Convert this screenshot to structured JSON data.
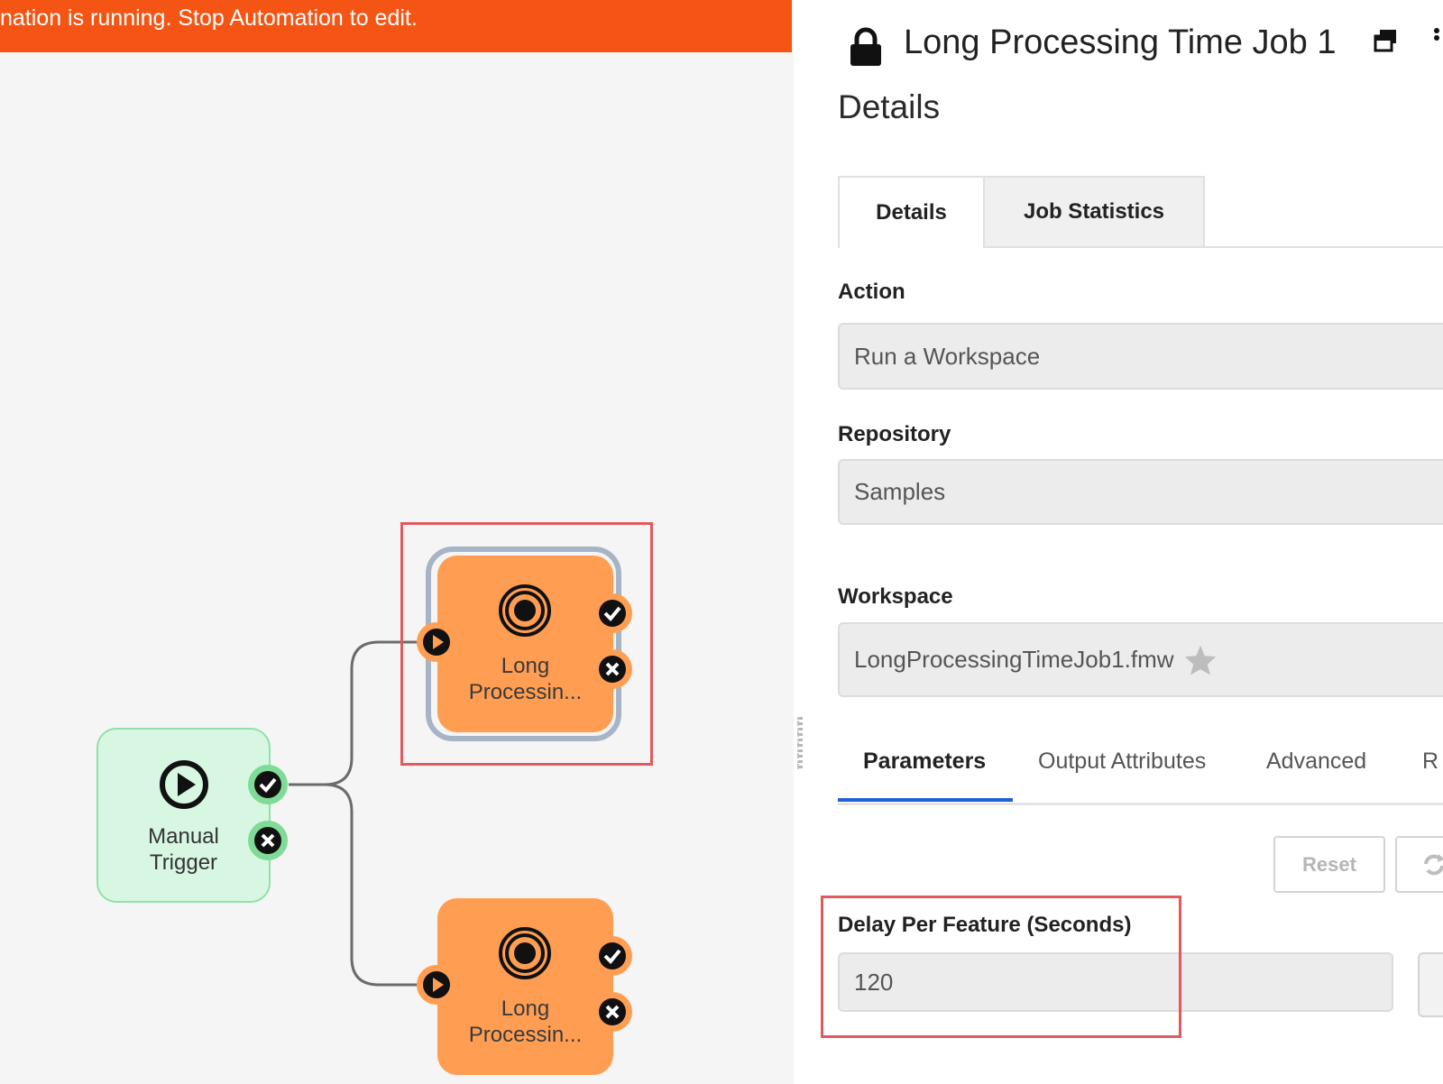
{
  "banner": {
    "text": "nation is running. Stop Automation to edit."
  },
  "colors": {
    "banner": "#f55514",
    "trigger_node": "#d7f7e2",
    "job_node": "#ff9e52",
    "selection": "#e3595d",
    "success_port": "#7fdb97",
    "active_tab": "#1f5fd6"
  },
  "canvas": {
    "trigger": {
      "label_line1": "Manual",
      "label_line2": "Trigger",
      "icon": "play-circle-icon"
    },
    "job1": {
      "label_line1": "Long",
      "label_line2": "Processin...",
      "icon": "target-icon"
    },
    "job2": {
      "label_line1": "Long",
      "label_line2": "Processin...",
      "icon": "target-icon"
    }
  },
  "panel": {
    "title": "Long Processing Time Job 1",
    "subheading": "Details",
    "tabs": [
      "Details",
      "Job Statistics"
    ],
    "action": {
      "label": "Action",
      "value": "Run a Workspace"
    },
    "repository": {
      "label": "Repository",
      "value": "Samples"
    },
    "workspace": {
      "label": "Workspace",
      "value": "LongProcessingTimeJob1.fmw"
    },
    "subtabs": [
      "Parameters",
      "Output Attributes",
      "Advanced",
      "R"
    ],
    "reset_label": "Reset",
    "parameter": {
      "label": "Delay Per Feature (Seconds)",
      "value": "120"
    }
  }
}
